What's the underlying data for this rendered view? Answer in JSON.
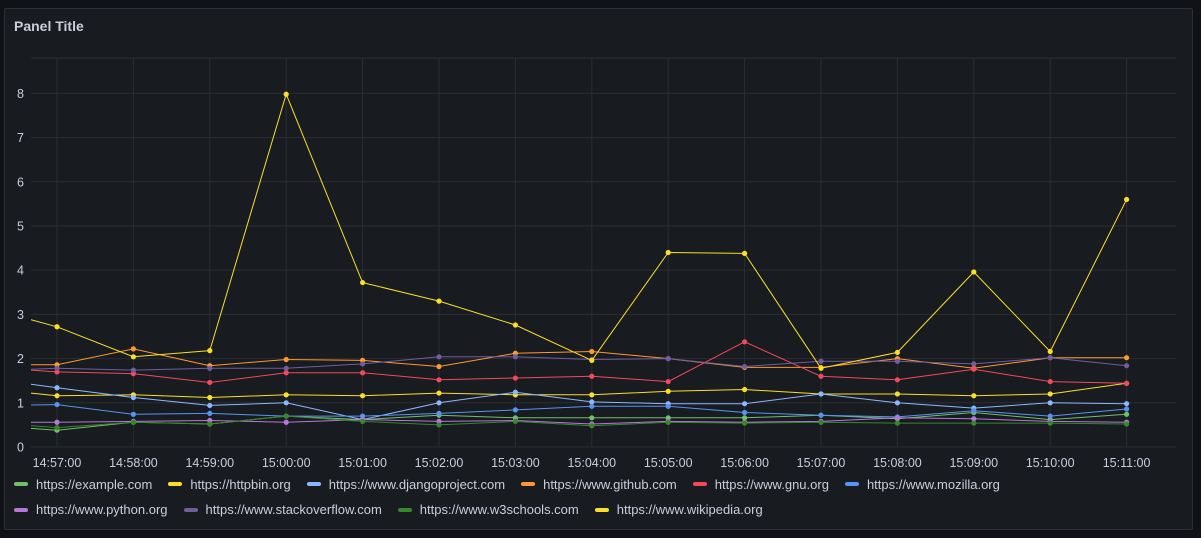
{
  "panel": {
    "title": "Panel Title"
  },
  "chart_data": {
    "type": "line",
    "x_labels": [
      "14:57:00",
      "14:58:00",
      "14:59:00",
      "15:00:00",
      "15:01:00",
      "15:02:00",
      "15:03:00",
      "15:04:00",
      "15:05:00",
      "15:06:00",
      "15:07:00",
      "15:08:00",
      "15:09:00",
      "15:10:00",
      "15:11:00"
    ],
    "ylim": [
      0,
      8.8
    ],
    "yticks": [
      0,
      1,
      2,
      3,
      4,
      5,
      6,
      7,
      8
    ],
    "grid": true,
    "legend_position": "bottom",
    "series": [
      {
        "name": "https://example.com",
        "color": "#73bf69",
        "start": 0.42,
        "values": [
          0.38,
          0.56,
          0.52,
          0.7,
          0.62,
          0.72,
          0.66,
          0.66,
          0.66,
          0.66,
          0.72,
          0.64,
          0.78,
          0.62,
          0.74
        ]
      },
      {
        "name": "https://httpbin.org",
        "color": "#fade2a",
        "start": 1.22,
        "values": [
          1.16,
          1.18,
          1.12,
          1.18,
          1.16,
          1.22,
          1.18,
          1.18,
          1.26,
          1.3,
          1.2,
          1.2,
          1.16,
          1.2,
          1.44
        ]
      },
      {
        "name": "https://www.djangoproject.com",
        "color": "#8ab8ff",
        "start": 1.42,
        "values": [
          1.34,
          1.12,
          0.94,
          1.0,
          0.62,
          1.0,
          1.24,
          1.02,
          0.98,
          0.98,
          1.2,
          1.0,
          0.88,
          1.0,
          0.98
        ]
      },
      {
        "name": "https://www.github.com",
        "color": "#ff9830",
        "start": 1.86,
        "values": [
          1.86,
          2.22,
          1.84,
          1.98,
          1.96,
          1.82,
          2.12,
          2.16,
          2.0,
          1.8,
          1.8,
          2.0,
          1.78,
          2.02,
          2.02
        ]
      },
      {
        "name": "https://www.gnu.org",
        "color": "#f2495c",
        "start": 1.74,
        "values": [
          1.7,
          1.66,
          1.46,
          1.68,
          1.68,
          1.52,
          1.56,
          1.6,
          1.48,
          2.38,
          1.6,
          1.52,
          1.76,
          1.48,
          1.44
        ]
      },
      {
        "name": "https://www.mozilla.org",
        "color": "#5794f2",
        "start": 0.95,
        "values": [
          0.96,
          0.74,
          0.76,
          0.7,
          0.7,
          0.76,
          0.84,
          0.92,
          0.92,
          0.78,
          0.72,
          0.68,
          0.82,
          0.7,
          0.86
        ]
      },
      {
        "name": "https://www.python.org",
        "color": "#b877d9",
        "start": 0.56,
        "values": [
          0.56,
          0.58,
          0.6,
          0.56,
          0.62,
          0.58,
          0.6,
          0.52,
          0.58,
          0.56,
          0.58,
          0.66,
          0.64,
          0.58,
          0.56
        ]
      },
      {
        "name": "https://www.stackoverflow.com",
        "color": "#705da0",
        "start": 1.76,
        "values": [
          1.78,
          1.74,
          1.78,
          1.78,
          1.88,
          2.04,
          2.04,
          1.98,
          2.0,
          1.82,
          1.94,
          1.94,
          1.88,
          2.02,
          1.84
        ]
      },
      {
        "name": "https://www.w3schools.com",
        "color": "#37872d",
        "start": 0.48,
        "values": [
          0.44,
          0.56,
          0.52,
          0.7,
          0.58,
          0.5,
          0.58,
          0.48,
          0.56,
          0.54,
          0.56,
          0.54,
          0.54,
          0.54,
          0.52
        ]
      },
      {
        "name": "https://www.wikipedia.org",
        "color": "#fade2a",
        "start": 2.88,
        "values": [
          2.72,
          2.04,
          2.18,
          7.98,
          3.72,
          3.3,
          2.76,
          1.96,
          4.4,
          4.38,
          1.78,
          2.14,
          3.96,
          2.16,
          5.6
        ]
      }
    ]
  }
}
